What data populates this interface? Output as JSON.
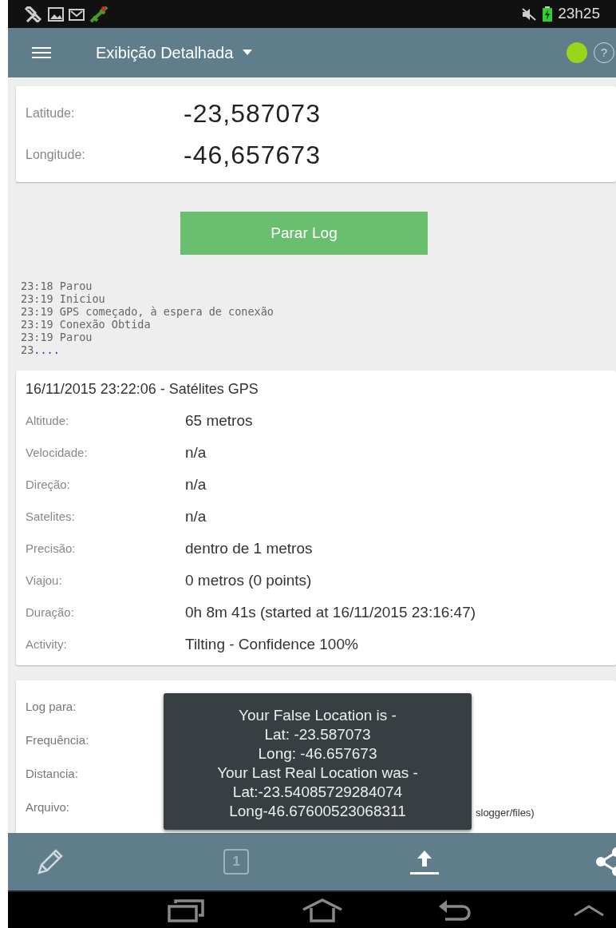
{
  "status_bar": {
    "time": "23h25"
  },
  "toolbar": {
    "title": "Exibição Detalhada",
    "gps_on": true,
    "help": "?"
  },
  "coordinates": [
    {
      "label": "Latitude:",
      "value": "-23,587073"
    },
    {
      "label": "Longitude:",
      "value": "-46,657673"
    }
  ],
  "action_button": "Parar Log",
  "log_lines": [
    "23:18 Parou",
    "23:19 Iniciou",
    "23:19 GPS começado, à espera de conexão",
    "23:19 Conexão Obtida",
    "23:19 Parou"
  ],
  "log_more": {
    "prefix": "23",
    "link": "...."
  },
  "details": {
    "title": "16/11/2015 23:22:06 - Satélites GPS",
    "rows": [
      {
        "label": "Altitude:",
        "value": "65 metros"
      },
      {
        "label": "Velocidade:",
        "value": "n/a"
      },
      {
        "label": "Direção:",
        "value": "n/a"
      },
      {
        "label": "Satelites:",
        "value": "n/a"
      },
      {
        "label": "Precisão:",
        "value": "dentro de 1 metros"
      },
      {
        "label": "Viajou:",
        "value": "0 metros (0 points)"
      },
      {
        "label": "Duração:",
        "value": "0h 8m 41s (started at 16/11/2015 23:16:47)"
      },
      {
        "label": "Activity:",
        "value": "Tilting - Confidence 100%"
      }
    ]
  },
  "settings": [
    {
      "label": "Log para:"
    },
    {
      "label": "Frequência:"
    },
    {
      "label": "Distancia:"
    },
    {
      "label": "Arquivo:",
      "value": "slogger/files)"
    }
  ],
  "toast": [
    "Your False Location is -",
    "Lat: -23.587073",
    "Long: -46.657673",
    "Your Last Real Location was -",
    "Lat:-23.54085729284074",
    "Long-46.67600523068311"
  ],
  "bottom_bar": {
    "counter": "1"
  }
}
